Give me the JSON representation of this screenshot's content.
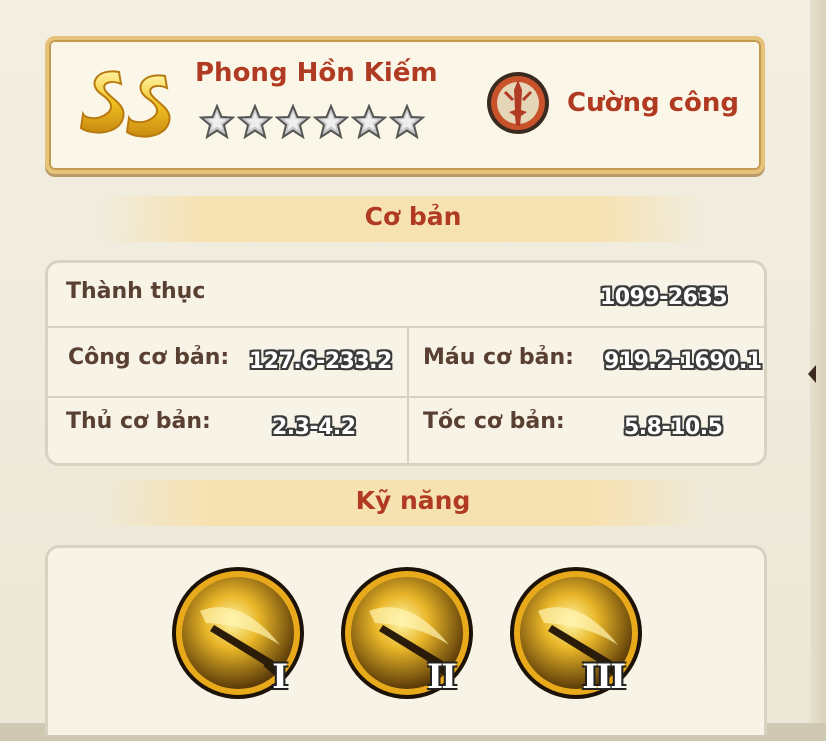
{
  "hero": {
    "grade": "SS",
    "name": "Phong Hồn Kiếm",
    "stars": 6,
    "class_label": "Cường công"
  },
  "sections": {
    "basic_title": "Cơ bản",
    "skills_title": "Kỹ năng"
  },
  "stats": {
    "proficiency_label": "Thành thục",
    "proficiency_value": "1099-2635",
    "attack_label": "Công cơ bản:",
    "attack_value": "127.6-233.2",
    "hp_label": "Máu cơ bản:",
    "hp_value": "919.2-1690.1",
    "defense_label": "Thủ cơ bản:",
    "defense_value": "2.3-4.2",
    "speed_label": "Tốc cơ bản:",
    "speed_value": "5.8-10.5"
  },
  "skills": [
    {
      "numeral": "I"
    },
    {
      "numeral": "II"
    },
    {
      "numeral": "III"
    }
  ],
  "colors": {
    "title_red": "#b03a22",
    "label_brown": "#5a4032",
    "card_border_gold": "#e7c27a"
  }
}
